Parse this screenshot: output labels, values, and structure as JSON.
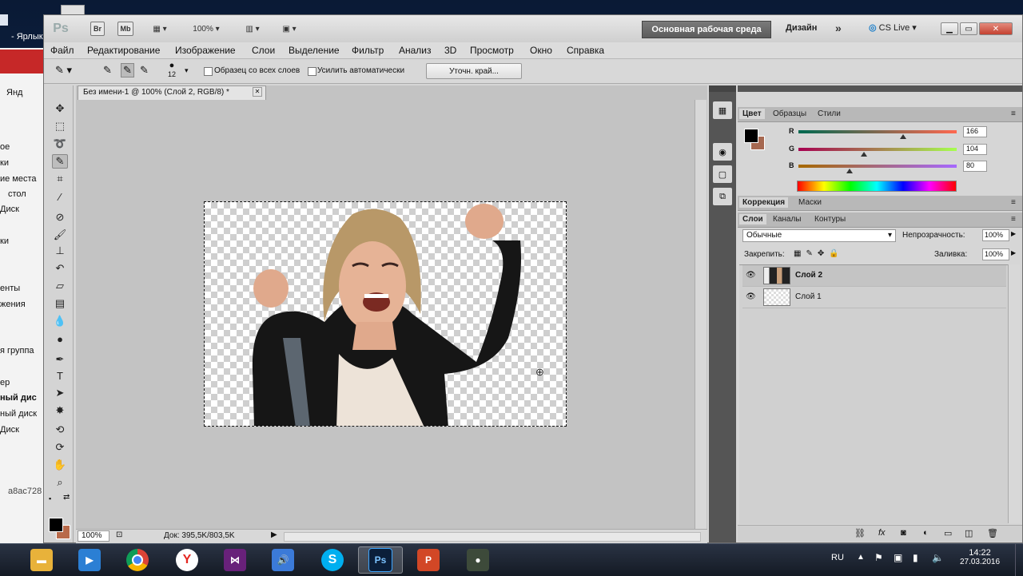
{
  "desktop": {
    "shortcut_label": "- Ярлык",
    "bg_window": {
      "tab_label": "Янд",
      "items": [
        "ое",
        "ки",
        "ие места",
        "стол",
        "Диск",
        "ки",
        "енты",
        "жения",
        "я группа",
        "ер",
        "ный дис",
        "ный диск",
        "Диск",
        "a8ac728"
      ]
    }
  },
  "titlebar": {
    "app_logo": "Ps",
    "bridge_label": "Br",
    "minibridge_label": "Mb",
    "zoom_label": "100%",
    "workspace_active": "Основная рабочая среда",
    "workspace_other": "Дизайн",
    "more_label": "»",
    "cs_live": "CS Live"
  },
  "menu": [
    "Файл",
    "Редактирование",
    "Изображение",
    "Слои",
    "Выделение",
    "Фильтр",
    "Анализ",
    "3D",
    "Просмотр",
    "Окно",
    "Справка"
  ],
  "options": {
    "brush_size": "12",
    "sample_all_layers": "Образец со всех слоев",
    "auto_enhance": "Усилить автоматически",
    "refine_edge": "Уточн. край..."
  },
  "document": {
    "tab_title": "Без имени-1 @ 100% (Слой 2, RGB/8) *",
    "zoom": "100%",
    "doc_info": "Док: 395,5K/803,5K"
  },
  "color_panel": {
    "tabs": [
      "Цвет",
      "Образцы",
      "Стили"
    ],
    "r_label": "R",
    "g_label": "G",
    "b_label": "B",
    "r": "166",
    "g": "104",
    "b": "80",
    "bg_color": "#a66850"
  },
  "adjust_panel": {
    "tabs": [
      "Коррекция",
      "Маски"
    ]
  },
  "layers_panel": {
    "tabs": [
      "Слои",
      "Каналы",
      "Контуры"
    ],
    "blend_mode": "Обычные",
    "opacity_label": "Непрозрачность:",
    "opacity": "100%",
    "lock_label": "Закрепить:",
    "fill_label": "Заливка:",
    "fill": "100%",
    "layers": [
      {
        "name": "Слой 2",
        "selected": true
      },
      {
        "name": "Слой 1",
        "selected": false
      }
    ]
  },
  "taskbar": {
    "lang": "RU",
    "time": "14:22",
    "date": "27.03.2016",
    "ps_label": "Ps"
  }
}
